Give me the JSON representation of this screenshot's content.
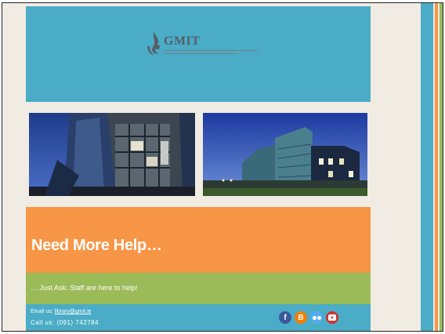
{
  "header": {
    "logo_text": "GMIT",
    "logo_alt": "GMIT logo",
    "colors": {
      "background": "#4aacc6"
    }
  },
  "photos": [
    {
      "label": "GMIT building interior glass facade photo"
    },
    {
      "label": "GMIT campus buildings at dusk photo"
    }
  ],
  "help": {
    "title": "Need More Help…",
    "subtitle": "… Just Ask: Staff are here to help!",
    "colors": {
      "orange": "#f79646",
      "green": "#9bbb59"
    }
  },
  "contact": {
    "email_label": "Email us:",
    "email": "library@gmit.ie",
    "phone": "Call us: (091) 742784"
  },
  "social": [
    {
      "name": "facebook-icon",
      "glyph": "f"
    },
    {
      "name": "blogger-icon",
      "glyph": "B"
    },
    {
      "name": "flickr-icon",
      "glyph": "●●"
    },
    {
      "name": "youtube-icon",
      "glyph": "▶"
    }
  ],
  "colors": {
    "page": "#f0ece4",
    "blue": "#4aacc6",
    "orange": "#f79646",
    "green": "#9bbb59"
  }
}
